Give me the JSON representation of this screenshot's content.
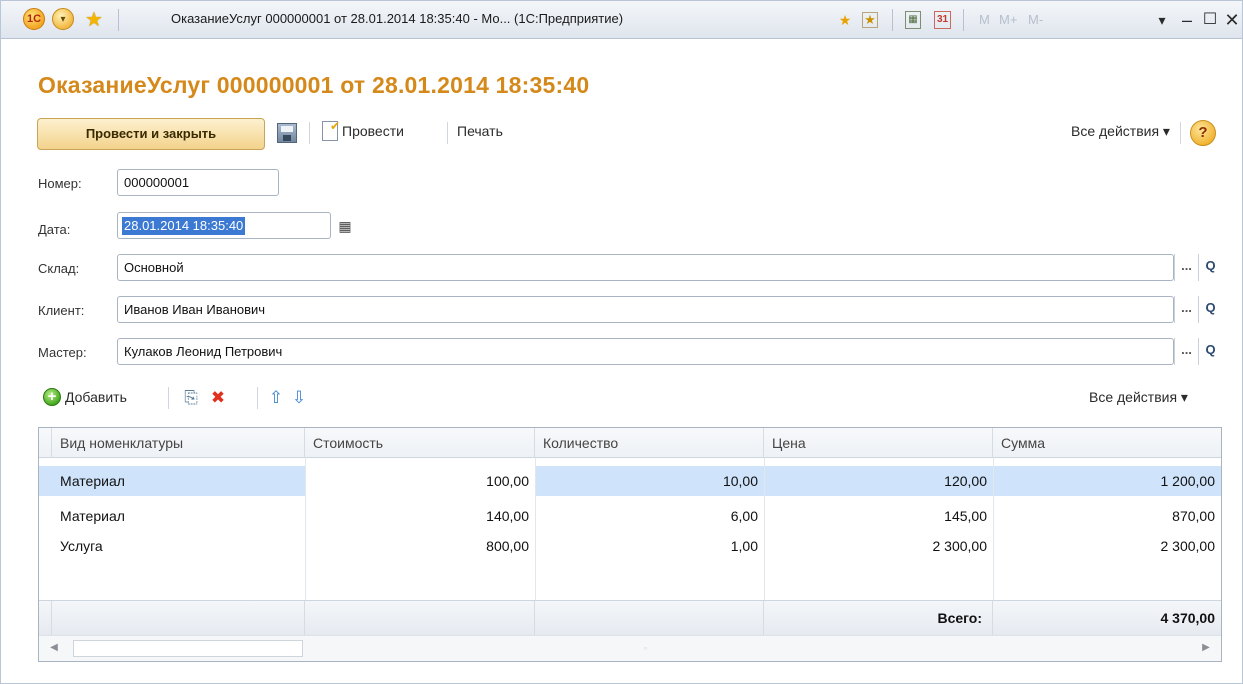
{
  "window": {
    "title": "ОказаниеУслуг 000000001 от 28.01.2014 18:35:40 - Мо... (1С:Предприятие)",
    "app_icon_text": "1С",
    "mem_buttons": [
      "M",
      "M+",
      "M-"
    ]
  },
  "document": {
    "title": "ОказаниеУслуг 000000001 от 28.01.2014 18:35:40"
  },
  "commandbar": {
    "post_and_close": "Провести и закрыть",
    "post": "Провести",
    "print": "Печать",
    "all_actions": "Все действия ▾",
    "help": "?"
  },
  "form": {
    "number_label": "Номер:",
    "number_value": "000000001",
    "date_label": "Дата:",
    "date_value": "28.01.2014 18:35:40",
    "warehouse_label": "Склад:",
    "warehouse_value": "Основной",
    "client_label": "Клиент:",
    "client_value": "Иванов Иван Иванович",
    "master_label": "Мастер:",
    "master_value": "Кулаков Леонид Петрович",
    "select_button": "...",
    "open_button": "Q"
  },
  "table_toolbar": {
    "add": "Добавить",
    "all_actions": "Все действия ▾"
  },
  "table": {
    "columns": [
      "Вид номенклатуры",
      "Стоимость",
      "Количество",
      "Цена",
      "Сумма"
    ],
    "rows": [
      {
        "type": "Материал",
        "cost": "100,00",
        "qty": "10,00",
        "price": "120,00",
        "sum": "1 200,00"
      },
      {
        "type": "Материал",
        "cost": "140,00",
        "qty": "6,00",
        "price": "145,00",
        "sum": "870,00"
      },
      {
        "type": "Услуга",
        "cost": "800,00",
        "qty": "1,00",
        "price": "2 300,00",
        "sum": "2 300,00"
      }
    ],
    "total_label": "Всего:",
    "total_value": "4 370,00"
  },
  "colors": {
    "title_accent": "#d4891a",
    "selection": "#cfe3fb",
    "primary_button": "#f3d38c"
  }
}
